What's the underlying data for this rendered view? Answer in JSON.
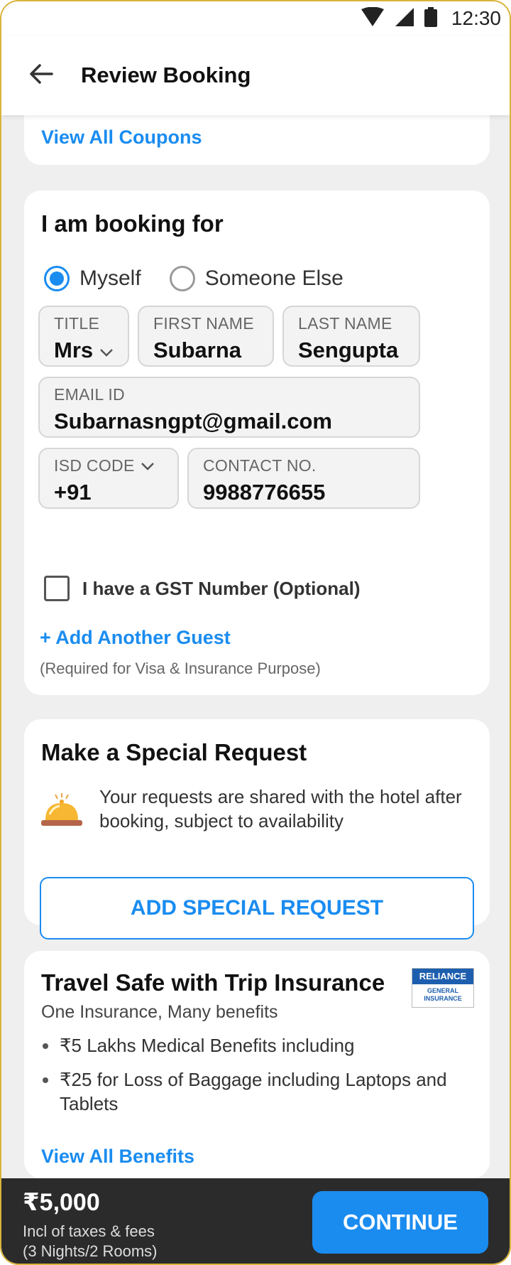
{
  "status_bar": {
    "time": "12:30",
    "icons": [
      "wifi-icon",
      "signal-icon",
      "battery-icon"
    ]
  },
  "header": {
    "title": "Review Booking",
    "back_icon": "arrow-left-icon"
  },
  "coupons": {
    "view_all_label": "View All Coupons"
  },
  "booking_for": {
    "title": "I am booking for",
    "options": [
      {
        "label": "Myself",
        "selected": true
      },
      {
        "label": "Someone Else",
        "selected": false
      }
    ],
    "fields": {
      "title": {
        "label": "TITLE",
        "value": "Mrs"
      },
      "first_name": {
        "label": "FIRST NAME",
        "value": "Subarna"
      },
      "last_name": {
        "label": "LAST NAME",
        "value": "Sengupta"
      },
      "email": {
        "label": "EMAIL ID",
        "value": "Subarnasngpt@gmail.com"
      },
      "isd_code": {
        "label": "ISD CODE",
        "value": "+91"
      },
      "contact": {
        "label": "CONTACT NO.",
        "value": "9988776655"
      }
    },
    "gst_label": "I have a GST Number (Optional)",
    "gst_checked": false,
    "add_guest_label": "+ Add Another Guest",
    "add_guest_note": "(Required for Visa & Insurance Purpose)"
  },
  "special_request": {
    "title": "Make a Special Request",
    "note": "Your requests are shared with the hotel after booking, subject to availability",
    "icon": "service-bell-icon",
    "button_label": "ADD SPECIAL REQUEST"
  },
  "insurance": {
    "title": "Travel Safe with Trip Insurance",
    "subtitle": "One Insurance, Many benefits",
    "logo_top": "RELIANCE",
    "logo_bottom_1": "GENERAL",
    "logo_bottom_2": "INSURANCE",
    "benefits": [
      "₹5 Lakhs Medical Benefits including",
      "₹25 for Loss of Baggage including Laptops and Tablets"
    ],
    "view_all_label": "View All Benefits"
  },
  "footer": {
    "price": "₹5,000",
    "note1": "Incl of taxes & fees",
    "note2": "(3 Nights/2 Rooms)",
    "continue_label": "CONTINUE"
  },
  "colors": {
    "accent": "#1a8cf0",
    "footer_bg": "#2b2b2b",
    "page_bg": "#efefef"
  }
}
